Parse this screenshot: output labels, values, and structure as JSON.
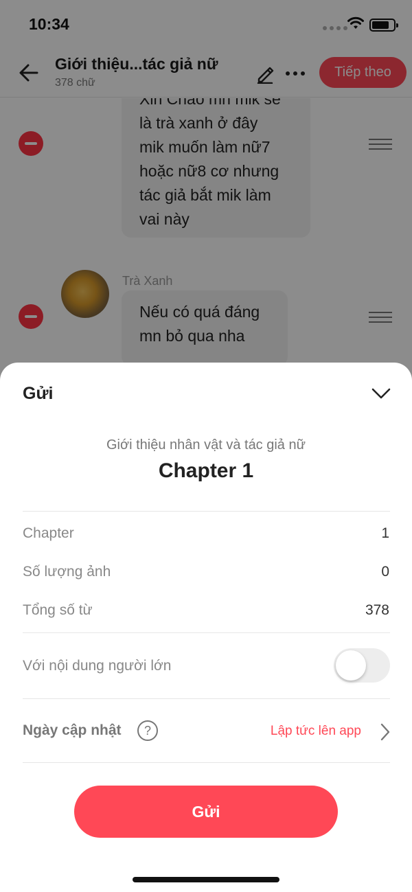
{
  "status_bar": {
    "time": "10:34"
  },
  "nav": {
    "title": "Giới thiệu...tác giả nữ",
    "subtitle": "378 chữ",
    "next_label": "Tiếp theo"
  },
  "chat": {
    "message1_partial": "Xin Chào mn mik sẽ",
    "message1": [
      "là trà xanh ở đây",
      "mik muốn làm nữ7",
      "hoặc nữ8 cơ nhưng",
      "tác giả bắt mik làm",
      "vai này"
    ],
    "sender2": "Trà Xanh",
    "message2": [
      "Nếu có quá đáng",
      "mn bỏ qua nha"
    ]
  },
  "sheet": {
    "title": "Gửi",
    "story_title": "Giới thiệu nhân vật và tác giả nữ",
    "chapter_title": "Chapter 1",
    "rows": [
      {
        "label": "Chapter",
        "value": "1"
      },
      {
        "label": "Số lượng ảnh",
        "value": "0"
      },
      {
        "label": "Tổng số từ",
        "value": "378"
      }
    ],
    "adult_label": "Với nội dung người lớn",
    "adult_enabled": false,
    "update_label": "Ngày cập nhật",
    "help_glyph": "?",
    "update_value": "Lập tức lên app",
    "send_label": "Gửi"
  },
  "icons": {
    "back": "arrow-left-icon",
    "edit": "pencil-icon",
    "more": "more-dots-icon",
    "remove": "minus-circle-icon",
    "drag": "drag-handle-icon",
    "collapse": "chevron-down-icon",
    "help": "question-circle-icon",
    "forward": "chevron-right-icon"
  },
  "colors": {
    "accent": "#ff4856",
    "remove": "#ff3344"
  }
}
